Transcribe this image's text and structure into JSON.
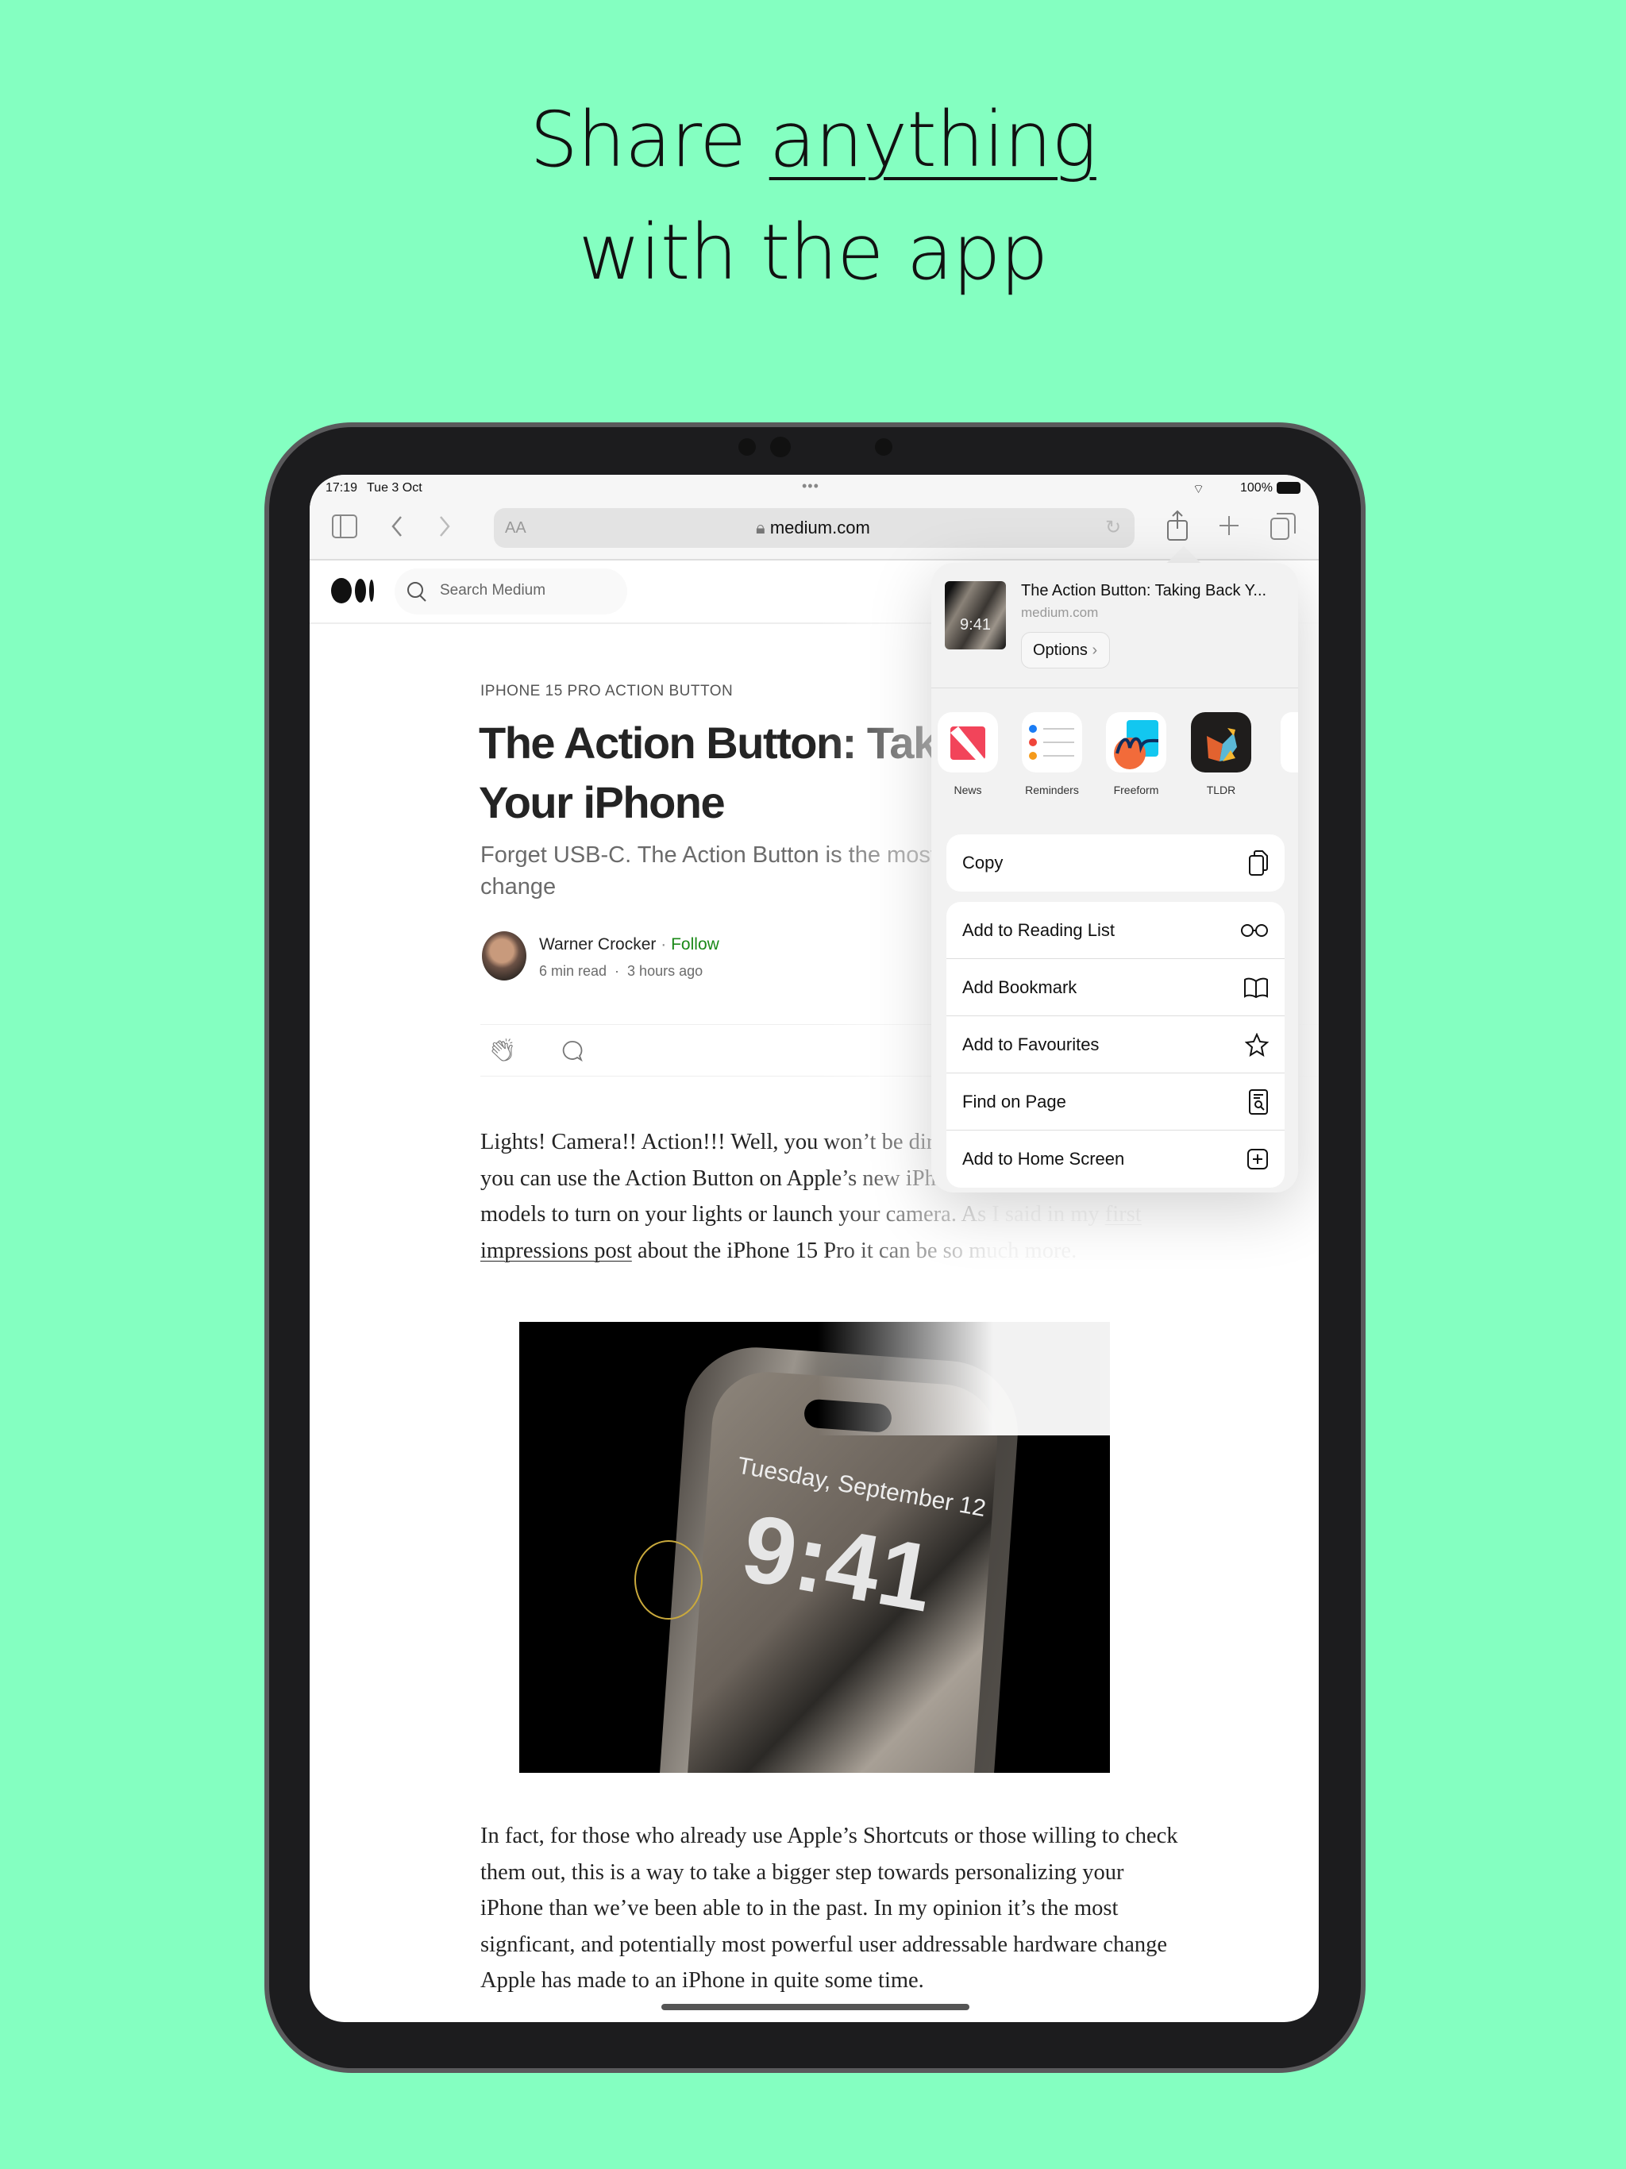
{
  "promo": {
    "line1_prefix": "Share ",
    "line1_emphasis": "anything",
    "line2": "with the app"
  },
  "status_bar": {
    "time": "17:19",
    "date": "Tue 3 Oct",
    "battery": "100%",
    "battery_level": 1.0
  },
  "toolbar": {
    "reader_label": "AA",
    "url": "medium.com"
  },
  "medium": {
    "search_placeholder": "Search Medium",
    "kicker": "IPHONE 15 PRO ACTION BUTTON",
    "title_line1": "The Action Button: Takin",
    "title_line2": "Your iPhone",
    "subtitle_line1": "Forget USB-C. The Action Button is the most sig",
    "subtitle_line2": "change",
    "author": "Warner Crocker",
    "follow": "Follow",
    "read_time": "6 min read",
    "posted": "3 hours ago",
    "para1": [
      "Lights! Camera!! Action!!! Well, you won’t be directin",
      "you can use the Action Button on Apple’s new iPhon",
      "models to turn on your lights or launch your camera. As I said in my ",
      "about the iPhone 15 Pro it can be so much more."
    ],
    "para1_link_a": "first",
    "para1_link_b": "impressions post",
    "image": {
      "date": "Tuesday, September 12",
      "time": "9:41"
    },
    "para2": [
      "In fact, for those who already use Apple’s Shortcuts or those willing to check",
      "them out, this is a way to take a bigger step towards personalizing your",
      "iPhone than we’ve been able to in the past. In my opinion it’s the most",
      "signficant, and potentially most powerful user addressable hardware change",
      "Apple has made to an iPhone in quite some time."
    ]
  },
  "share_sheet": {
    "title": "The Action Button: Taking Back Y...",
    "domain": "medium.com",
    "options": "Options",
    "thumb_time": "9:41",
    "apps": [
      {
        "label": "News"
      },
      {
        "label": "Reminders"
      },
      {
        "label": "Freeform"
      },
      {
        "label": "TLDR"
      }
    ],
    "copy": "Copy",
    "actions": [
      {
        "label": "Add to Reading List",
        "icon": "glasses-icon"
      },
      {
        "label": "Add Bookmark",
        "icon": "book-icon"
      },
      {
        "label": "Add to Favourites",
        "icon": "star-icon"
      },
      {
        "label": "Find on Page",
        "icon": "find-page-icon"
      },
      {
        "label": "Add to Home Screen",
        "icon": "plus-square-icon"
      }
    ]
  },
  "colors": {
    "background": "#84ffc1",
    "follow": "#1a8917",
    "bezel": "#1c1c1e"
  }
}
